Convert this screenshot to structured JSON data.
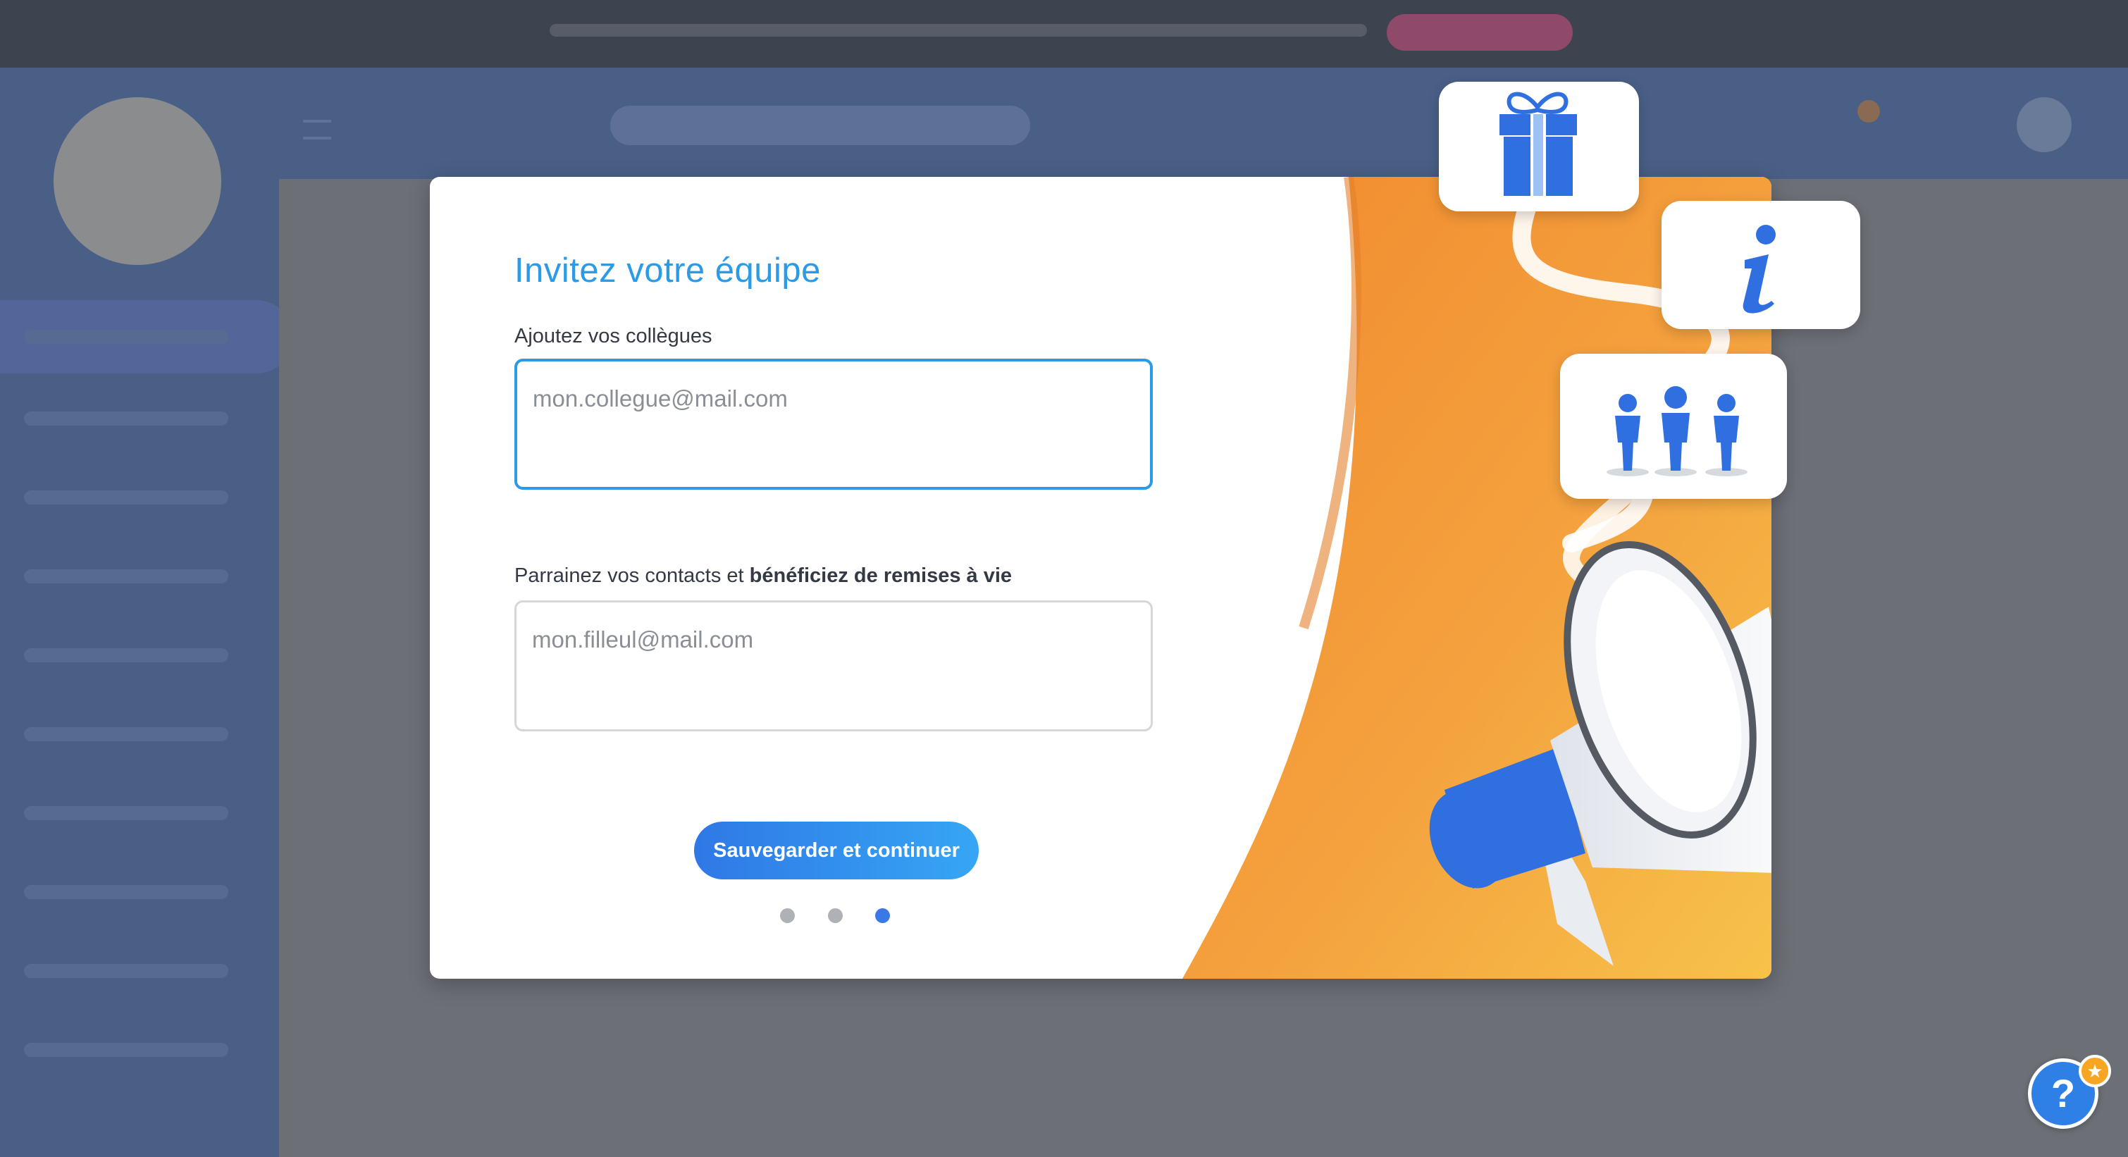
{
  "modal": {
    "title": "Invitez votre équipe",
    "colleagues_label": "Ajoutez vos collègues",
    "colleagues_placeholder": "mon.collegue@mail.com",
    "referral_label_prefix": "Parrainez vos contacts et ",
    "referral_label_bold": "bénéficiez de remises à vie",
    "referral_placeholder": "mon.filleul@mail.com",
    "save_button": "Sauvegarder et continuer",
    "steps": {
      "total": 3,
      "current": 3
    }
  },
  "help": {
    "label": "?",
    "badge": "★"
  },
  "icons": [
    "gift-icon",
    "info-icon",
    "team-icon",
    "megaphone-icon",
    "help-icon",
    "star-icon"
  ],
  "colors": {
    "accent": "#2b9be8",
    "button": "#2f78e6",
    "illustration_orange": "#f4a13e",
    "badge": "#f6a623"
  }
}
